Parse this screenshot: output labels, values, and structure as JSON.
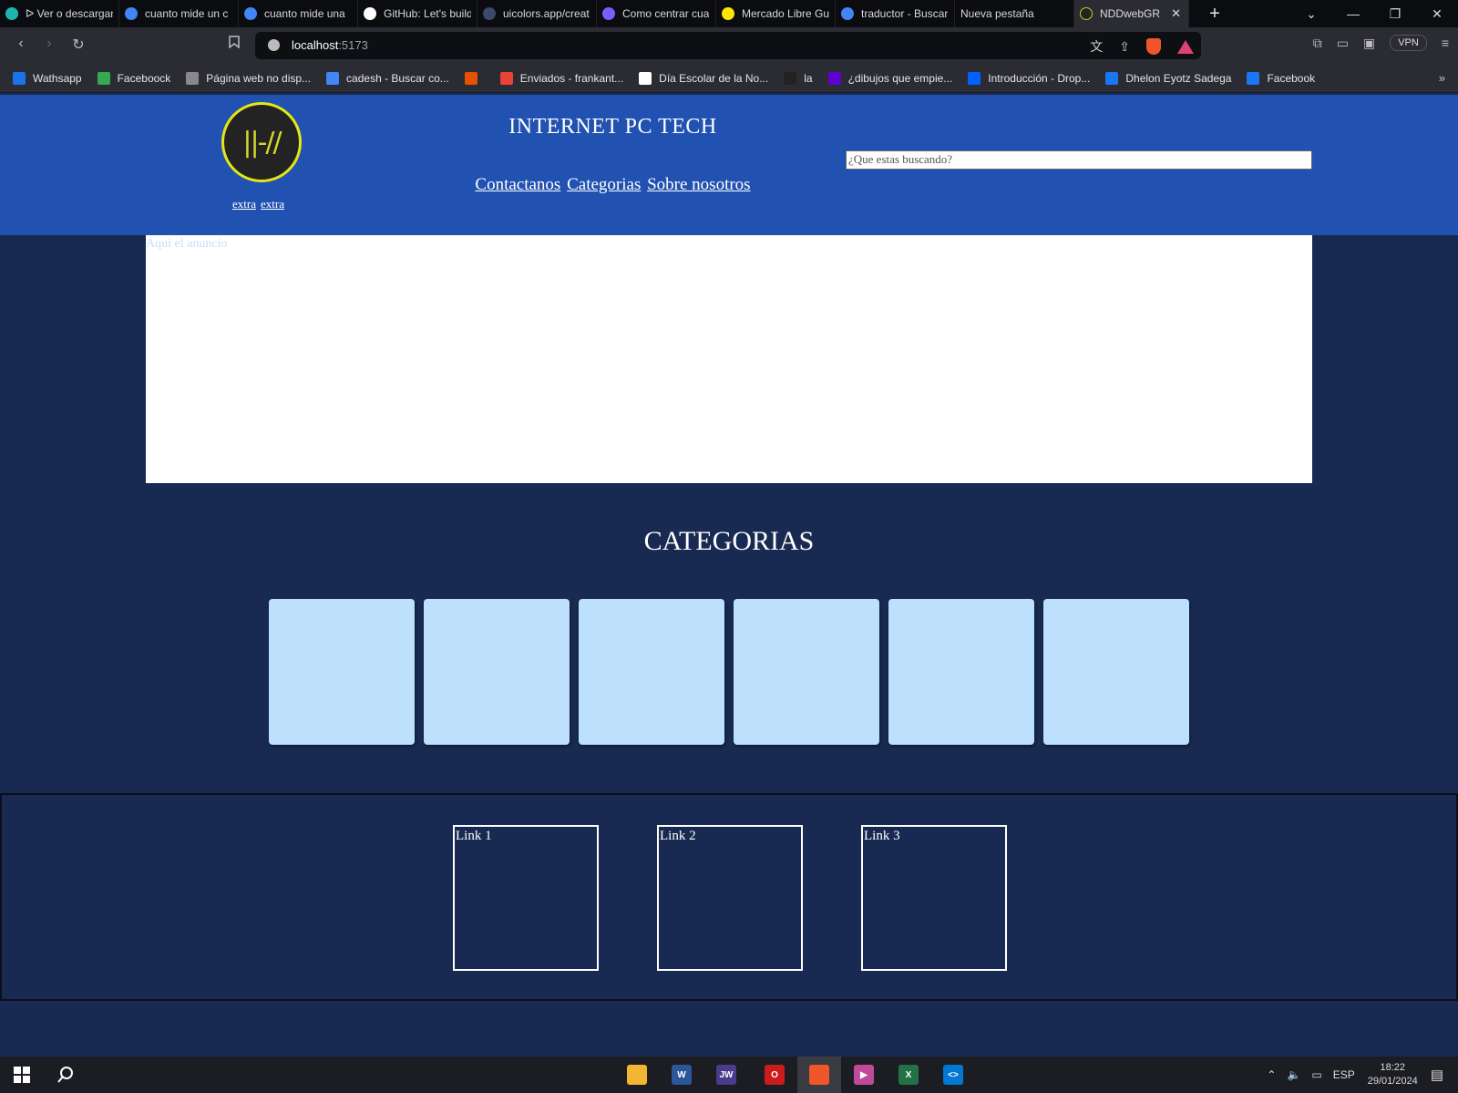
{
  "browser": {
    "tabs": [
      {
        "title": "ᐅ Ver o descargar",
        "icon": "c-app-icon",
        "color": "#1fb5ac"
      },
      {
        "title": "cuanto mide un c",
        "icon": "google-icon",
        "color": "#4285f4"
      },
      {
        "title": "cuanto mide una",
        "icon": "google-icon",
        "color": "#4285f4"
      },
      {
        "title": "GitHub: Let's build",
        "icon": "github-icon",
        "color": "#ffffff"
      },
      {
        "title": "uicolors.app/creat",
        "icon": "ui-icon",
        "color": "#3b4a6b"
      },
      {
        "title": "Como centrar cua",
        "icon": "astro-icon",
        "color": "#7c5cff"
      },
      {
        "title": "Mercado Libre Gu",
        "icon": "mercadolibre-icon",
        "color": "#ffe600"
      },
      {
        "title": "traductor - Buscar",
        "icon": "google-icon",
        "color": "#4285f4"
      },
      {
        "title": "Nueva pestaña",
        "icon": "",
        "color": ""
      }
    ],
    "active_tab": {
      "title": "NDDwebGR",
      "close": "✕"
    },
    "new_tab": "+",
    "window": {
      "dropdown": "⌄",
      "minimize": "—",
      "restore": "❐",
      "close": "✕"
    },
    "nav": {
      "back": "‹",
      "forward": "›",
      "reload": "↻",
      "bookmark": "🔖"
    },
    "url": {
      "host": "localhost",
      "port": ":5173"
    },
    "vpn_label": "VPN",
    "bookmarks": [
      {
        "label": "Wathsapp",
        "icon": "play-icon",
        "color": "#1a73e8"
      },
      {
        "label": "Faceboock",
        "icon": "play-icon",
        "color": "#34a853"
      },
      {
        "label": "Página web no disp...",
        "icon": "globe-icon",
        "color": "#888888"
      },
      {
        "label": "cadesh - Buscar co...",
        "icon": "google-icon",
        "color": "#4285f4"
      },
      {
        "label": "",
        "icon": "colorful-icon",
        "color": "#e65100"
      },
      {
        "label": "Enviados - frankant...",
        "icon": "gmail-icon",
        "color": "#ea4335"
      },
      {
        "label": "Día Escolar de la No...",
        "icon": "wikipedia-icon",
        "color": "#ffffff"
      },
      {
        "label": "la",
        "icon": "mask-icon",
        "color": "#222222"
      },
      {
        "label": "¿dibujos que empie...",
        "icon": "yahoo-icon",
        "color": "#5f01d1"
      },
      {
        "label": "Introducción - Drop...",
        "icon": "dropbox-icon",
        "color": "#0061ff"
      },
      {
        "label": "Dhelon Eyotz Sadega",
        "icon": "facebook-icon",
        "color": "#1877f2"
      },
      {
        "label": "Facebook",
        "icon": "facebook-icon",
        "color": "#1877f2"
      }
    ],
    "bookmarks_more": "»"
  },
  "site": {
    "logo_text": "||-//",
    "extra_links": [
      "extra",
      "extra"
    ],
    "title": "INTERNET PC TECH",
    "nav": [
      "Contactanos",
      "Categorias",
      "Sobre nosotros"
    ],
    "search_placeholder": "¿Que estas buscando?",
    "ad_text": "Aqui el anuncio",
    "categories_heading": "CATEGORIAS",
    "category_count": 6,
    "footer_links": [
      "Link 1",
      "Link 2",
      "Link 3"
    ],
    "colors": {
      "header": "#2152b1",
      "page": "#182a52",
      "card": "#bde0fd",
      "logo_ring": "#e6e613"
    }
  },
  "taskbar": {
    "apps": [
      {
        "name": "file-explorer-icon",
        "color": "#f2b632",
        "label": ""
      },
      {
        "name": "word-icon",
        "color": "#2b579a",
        "label": "W"
      },
      {
        "name": "jw-icon",
        "color": "#4a3b8c",
        "label": "JW"
      },
      {
        "name": "opera-icon",
        "color": "#cc1b1b",
        "label": "O"
      },
      {
        "name": "brave-icon",
        "color": "#f1562b",
        "label": ""
      },
      {
        "name": "media-player-icon",
        "color": "#c04a9a",
        "label": "▶"
      },
      {
        "name": "excel-icon",
        "color": "#217346",
        "label": "X"
      },
      {
        "name": "vscode-icon",
        "color": "#0078d4",
        "label": "<>"
      }
    ],
    "language": "ESP",
    "time": "18:22",
    "date": "29/01/2024"
  }
}
